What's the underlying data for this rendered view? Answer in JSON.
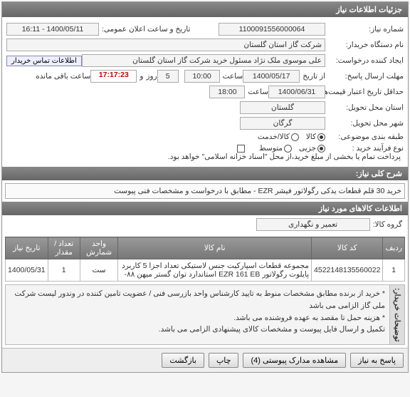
{
  "panel_title": "جزئیات اطلاعات نیاز",
  "labels": {
    "need_no": "شماره نیاز:",
    "buyer_org": "نام دستگاه خریدار:",
    "requester": "ایجاد کننده درخواست:",
    "deadline": "مهلت ارسال پاسخ:",
    "validity": "حداقل تاریخ اعتبار قیمت‌ها تا تاریخ:",
    "province": "استان محل تحویل:",
    "city": "شهر محل تحویل:",
    "categorize": "طبقه بندی موضوعی:",
    "process_type": "نوع فرآیند خرید :",
    "announce": "تاریخ و ساعت اعلان عمومی:",
    "from_date": "از تاریخ",
    "at_time": "ساعت",
    "and": "و",
    "day": "روز",
    "remaining": "ساعت باقی مانده",
    "contact_btn": "اطلاعات تماس خریدار",
    "pay_note": "پرداخت تمام یا بخشی از مبلغ خرید،از محل \"اسناد خزانه اسلامی\" خواهد بود."
  },
  "values": {
    "need_no": "1100091556000064",
    "buyer_org": "شرکت گاز استان گلستان",
    "requester": "علی موسوی ملک نژاد مسئول خرید شرکت گاز استان گلستان",
    "deadline_date": "1400/05/17",
    "deadline_time": "10:00",
    "days_remain": "5",
    "countdown": "17:17:23",
    "validity_date": "1400/06/31",
    "validity_time": "18:00",
    "province": "گلستان",
    "city": "گرگان",
    "announce": "1400/05/11 - 16:11"
  },
  "radios": {
    "cat": [
      {
        "label": "کالا",
        "selected": true
      },
      {
        "label": "کالا/خدمت",
        "selected": false
      }
    ],
    "proc": [
      {
        "label": "جزیی",
        "selected": true
      },
      {
        "label": "متوسط",
        "selected": false
      }
    ]
  },
  "pay_checked": false,
  "need_desc": {
    "title": "شرح کلی نیاز:",
    "text": "خرید 30 قلم قطعات یدکی رگولاتور فیشر EZR - مطابق با درخواست و مشخصات فنی پیوست"
  },
  "items_section": "اطلاعات کالاهای مورد نیاز",
  "group_label": "گروه کالا:",
  "group_value": "تعمیر و نگهداری",
  "table": {
    "headers": [
      "ردیف",
      "کد کالا",
      "نام کالا",
      "واحد شمارش",
      "تعداد / مقدار",
      "تاریخ نیاز"
    ],
    "rows": [
      {
        "idx": "1",
        "code": "4522148135560022",
        "name": "مجموعه قطعات اسپارکیت جنس لاستیکی تعداد اجزا 5 کاربرد پایلوت رگولاتور EZR 161 EB استاندارد توان گستر میهن ۸۸-",
        "unit": "ست",
        "qty": "1",
        "date": "1400/05/31"
      }
    ]
  },
  "buyer_notes": {
    "label": "توضیحات خریدار:",
    "lines": [
      "* خرید از برنده مطابق مشخصات منوط به تایید کارشناس واحد بازرسی فنی / عضویت تامین کننده در وندور لیست شرکت ملی گاز الزامی می باشد",
      "* هزینه حمل تا مقصد به عهده فروشنده می باشد.",
      "تکمیل و ارسال فایل پیوست و مشخصات کالای پیشنهادی الزامی می باشد."
    ]
  },
  "buttons": {
    "reply": "پاسخ به نیاز",
    "attach": "مشاهده مدارک پیوستی (4)",
    "print": "چاپ",
    "back": "بازگشت"
  }
}
